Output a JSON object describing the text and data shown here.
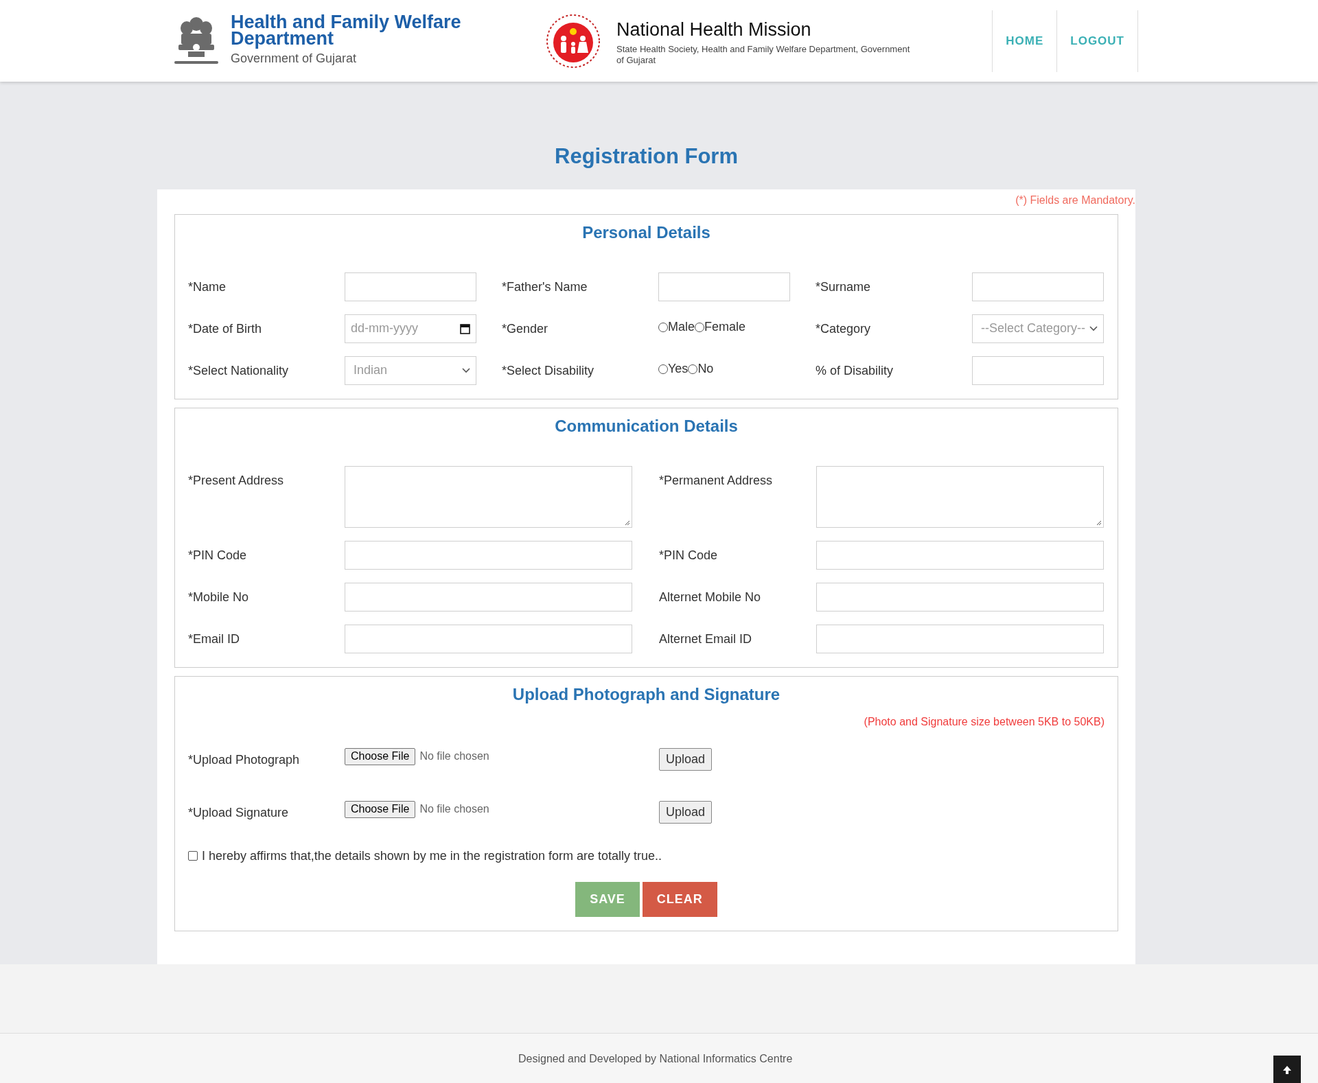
{
  "header": {
    "department_title": "Health and Family Welfare Department",
    "department_subtitle": "Government of Gujarat",
    "mission_title": "National Health Mission",
    "mission_subtitle": "State Health Society, Health and Family Welfare Department, Government of Gujarat",
    "nav": [
      {
        "label": "HOME"
      },
      {
        "label": "LOGOUT"
      }
    ]
  },
  "page_title": "Registration Form",
  "mandatory_note": "(*) Fields are Mandatory.",
  "personal_details": {
    "title": "Personal Details",
    "fields": [
      {
        "label": "*Name",
        "kind": "text"
      },
      {
        "label": "*Father's Name",
        "kind": "text"
      },
      {
        "label": "*Surname",
        "kind": "text"
      },
      {
        "label": "*Date of Birth",
        "kind": "date",
        "placeholder": "dd-mm-yyyy"
      },
      {
        "label": "*Gender",
        "kind": "radio",
        "options": [
          {
            "label": "Male",
            "selected": false
          },
          {
            "label": "Female",
            "selected": false
          }
        ]
      },
      {
        "label": "*Category",
        "kind": "select",
        "value": "--Select Category--"
      },
      {
        "label": "*Select Nationality",
        "kind": "select",
        "value": "Indian"
      },
      {
        "label": "*Select Disability",
        "kind": "radio",
        "options": [
          {
            "label": "Yes",
            "selected": false
          },
          {
            "label": "No",
            "selected": false
          }
        ]
      },
      {
        "label": "% of Disability",
        "kind": "text"
      }
    ]
  },
  "communication_details": {
    "title": "Communication Details",
    "fields": [
      {
        "label": "*Present Address",
        "kind": "textarea"
      },
      {
        "label": "*Permanent Address",
        "kind": "textarea"
      },
      {
        "label": "*PIN Code",
        "kind": "text"
      },
      {
        "label": "*PIN Code",
        "kind": "text"
      },
      {
        "label": "*Mobile No",
        "kind": "text"
      },
      {
        "label": "Alternet Mobile No",
        "kind": "text"
      },
      {
        "label": "*Email ID",
        "kind": "text"
      },
      {
        "label": "Alternet Email ID",
        "kind": "text"
      }
    ]
  },
  "upload": {
    "title": "Upload Photograph and Signature",
    "note": "(Photo and Signature size between 5KB to 50KB)",
    "items": [
      {
        "label": "*Upload Photograph",
        "choose_button": "Choose File",
        "status": "No file chosen",
        "upload_button": "Upload"
      },
      {
        "label": "*Upload Signature",
        "choose_button": "Choose File",
        "status": "No file chosen",
        "upload_button": "Upload"
      }
    ],
    "declaration": {
      "text": "I hereby affirms that,the details shown by me in the registration form are totally true..",
      "checked": false
    },
    "buttons": [
      {
        "label": "SAVE",
        "kind": "save"
      },
      {
        "label": "CLEAR",
        "kind": "clear"
      }
    ]
  },
  "footer": {
    "text": "Designed and Developed by National Informatics Centre"
  }
}
